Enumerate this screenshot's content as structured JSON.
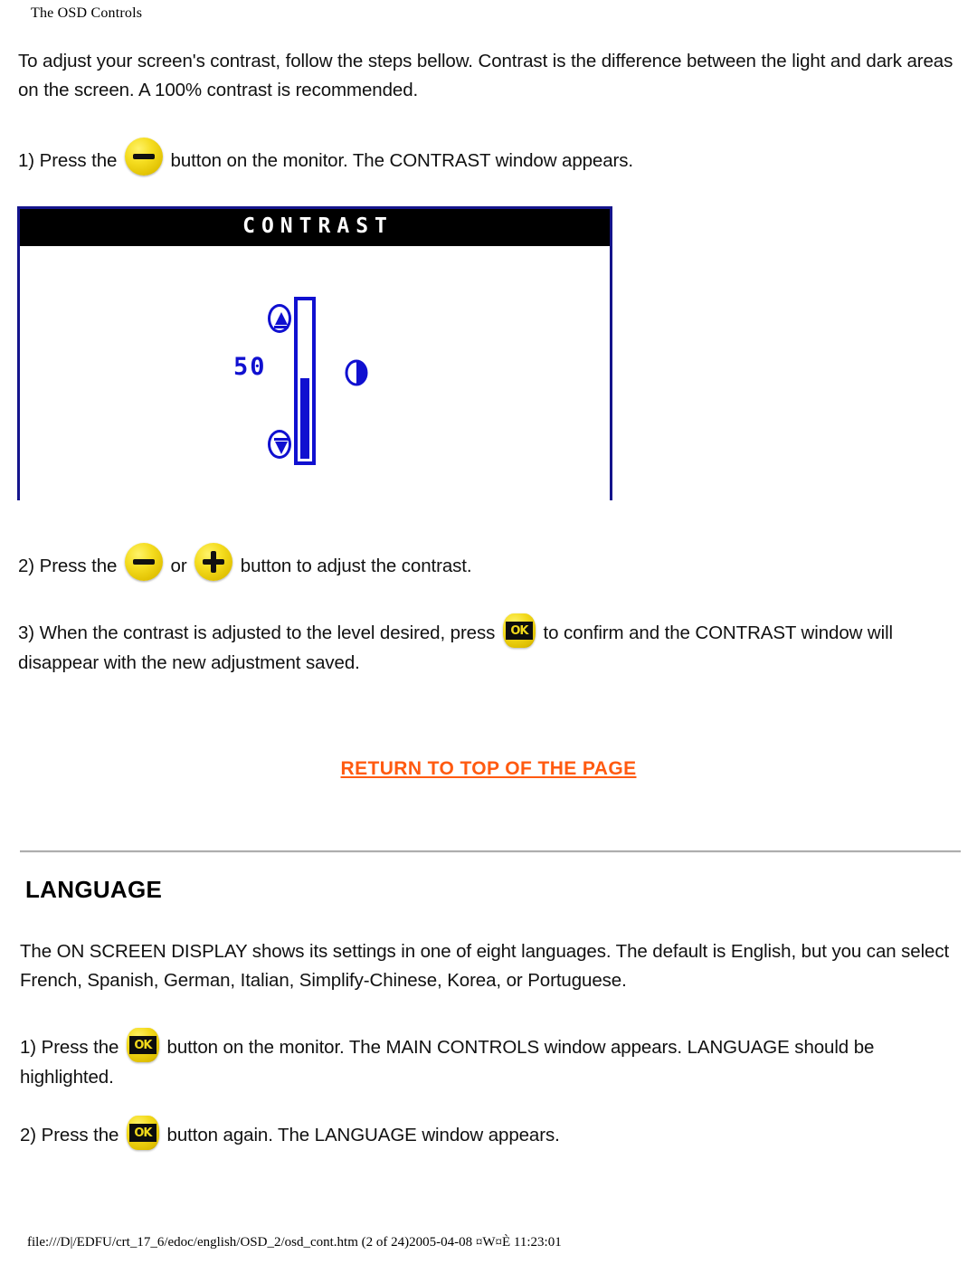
{
  "header": {
    "title": "The OSD Controls"
  },
  "contrast_section": {
    "intro": "To adjust your screen's contrast, follow the steps bellow. Contrast is the difference between the light and dark areas on the screen. A 100% contrast is recommended.",
    "step1_before": "1) Press the",
    "step1_after": "button on the monitor. The CONTRAST window appears.",
    "step2_before": "2) Press the",
    "step2_middle": "or",
    "step2_after": "button to adjust the contrast.",
    "step3_before": "3) When the contrast is adjusted to the level desired, press",
    "step3_after": "to confirm and the CONTRAST window will disappear with the new adjustment saved."
  },
  "osd": {
    "title": "CONTRAST",
    "value": "50",
    "fill_percent": 50,
    "up_icon": "up-arrow-icon",
    "down_icon": "down-arrow-icon",
    "contrast_icon": "contrast-half-circle-icon",
    "border_color": "#14148c",
    "accent_color": "#1010d0",
    "titlebar_color": "#000000"
  },
  "buttons": {
    "minus_label": "minus-button",
    "plus_label": "plus-button",
    "ok_label": "OK",
    "yellow": "#f3da1c"
  },
  "return_link": {
    "label": "RETURN TO TOP OF THE PAGE",
    "color": "#ff5a10"
  },
  "language_section": {
    "heading": "LANGUAGE",
    "intro": "The ON SCREEN DISPLAY shows its settings in one of eight languages. The default is English, but you can select French, Spanish, German, Italian, Simplify-Chinese, Korea, or Portuguese.",
    "step1_before": "1) Press the",
    "step1_after": "button on the monitor. The MAIN CONTROLS window appears. LANGUAGE should be highlighted.",
    "step2_before": "2) Press the",
    "step2_after": "button again. The LANGUAGE window appears."
  },
  "footer": {
    "path": "file:///D|/EDFU/crt_17_6/edoc/english/OSD_2/osd_cont.htm (2 of 24)2005-04-08 ¤W¤È 11:23:01"
  }
}
